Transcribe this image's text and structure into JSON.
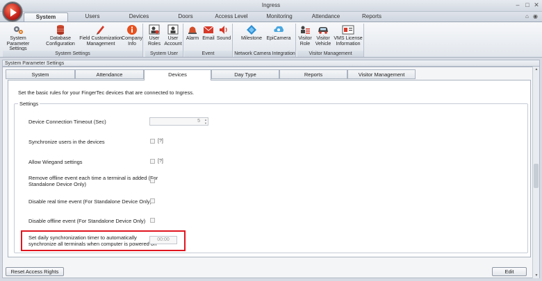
{
  "window": {
    "title": "Ingress",
    "controls": [
      "–",
      "□",
      "✕"
    ]
  },
  "ribbon_tabs": [
    "System Settings",
    "Users",
    "Devices",
    "Doors",
    "Access Level",
    "Monitoring",
    "Attendance",
    "Reports"
  ],
  "ribbon_groups": [
    {
      "label": "System Settings",
      "buttons": [
        {
          "l1": "System Parameter",
          "l2": "Settings",
          "icon": "gears-icon"
        },
        {
          "l1": "Database",
          "l2": "Configuration",
          "icon": "database-icon"
        },
        {
          "l1": "Field Customization",
          "l2": "Management",
          "icon": "pencil-icon"
        },
        {
          "l1": "Company",
          "l2": "Info",
          "icon": "info-icon"
        }
      ]
    },
    {
      "label": "System User",
      "buttons": [
        {
          "l1": "User",
          "l2": "Roles",
          "icon": "user-roles-icon"
        },
        {
          "l1": "User",
          "l2": "Account",
          "icon": "user-account-icon"
        }
      ]
    },
    {
      "label": "Event",
      "buttons": [
        {
          "l1": "Alarm",
          "l2": "",
          "icon": "alarm-icon"
        },
        {
          "l1": "Email",
          "l2": "",
          "icon": "email-icon"
        },
        {
          "l1": "Sound",
          "l2": "",
          "icon": "sound-icon"
        }
      ]
    },
    {
      "label": "Network Camera Integration",
      "buttons": [
        {
          "l1": "Milestone",
          "l2": "",
          "icon": "milestone-icon"
        },
        {
          "l1": "EpiCamera",
          "l2": "",
          "icon": "epicamera-icon"
        }
      ]
    },
    {
      "label": "Visitor Management",
      "buttons": [
        {
          "l1": "Visitor",
          "l2": "Role",
          "icon": "visitor-role-icon"
        },
        {
          "l1": "Visitor",
          "l2": "Vehicle",
          "icon": "vehicle-icon"
        },
        {
          "l1": "VMS License",
          "l2": "Information",
          "icon": "license-icon"
        }
      ]
    }
  ],
  "panel": {
    "header": "System Parameter Settings",
    "tabs": [
      "System",
      "Attendance",
      "Devices",
      "Day Type",
      "Reports",
      "Visitor Management"
    ],
    "active_tab": "Devices",
    "description": "Set the basic rules for your FingerTec devices that are connected to Ingress.",
    "legend": "Settings",
    "rows": [
      {
        "l1": "Device Connection Timeout (Sec)",
        "l2": "",
        "control": "spin",
        "value": "5"
      },
      {
        "l1": "Synchronize users in the devices",
        "l2": "",
        "control": "checkbox",
        "help": "[?]"
      },
      {
        "l1": "Allow Wiegand settings",
        "l2": "",
        "control": "checkbox",
        "help": "[?]"
      },
      {
        "l1": "Remove offline event each time a terminal is added (For",
        "l2": "Standalone Device Only)",
        "control": "checkbox"
      },
      {
        "l1": "Disable real time event (For Standalone Device Only)",
        "l2": "",
        "control": "checkbox"
      },
      {
        "l1": "Disable offline event (For Standalone Device Only)",
        "l2": "",
        "control": "checkbox"
      },
      {
        "l1": "Set daily synchronization timer to automatically",
        "l2": "synchronize all terminals when computer is powered on",
        "control": "time",
        "value": "00:00"
      }
    ],
    "reset_button": "Reset Access Rights",
    "edit_button": "Edit"
  },
  "colors": {
    "highlight": "#e0141e",
    "accent": "#c0201a"
  }
}
